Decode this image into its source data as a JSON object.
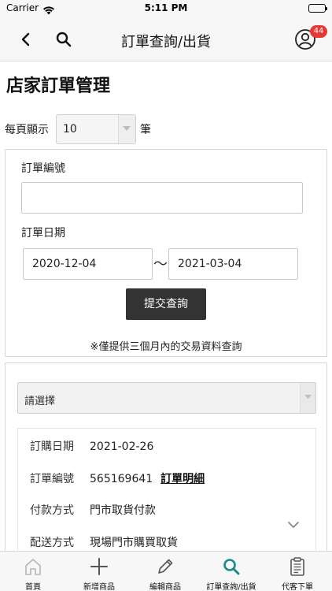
{
  "status_bar": {
    "carrier": "Carrier",
    "time": "5:11 PM"
  },
  "nav": {
    "title": "訂單查詢/出貨",
    "badge_count": "44"
  },
  "page": {
    "heading": "店家訂單管理"
  },
  "page_size": {
    "label": "每頁顯示",
    "value": "10",
    "unit": "筆"
  },
  "search": {
    "order_no_label": "訂單編號",
    "order_no_value": "",
    "date_label": "訂單日期",
    "date_from": "2020-12-04",
    "date_sep": "〜",
    "date_to": "2021-03-04",
    "submit_label": "提交查詢",
    "notice": "※僅提供三個月內的交易資料查詢"
  },
  "results": {
    "filter_value": "請選擇",
    "order": {
      "date_key": "訂購日期",
      "date_value": "2021-02-26",
      "no_key": "訂單編號",
      "no_value": "565169641",
      "detail_link": "訂單明細",
      "pay_key": "付款方式",
      "pay_value": "門市取貨付款",
      "ship_key": "配送方式",
      "ship_value": "現場門市購買取貨"
    }
  },
  "tabs": [
    {
      "label": "首頁",
      "icon": "home-icon"
    },
    {
      "label": "新增商品",
      "icon": "plus-icon"
    },
    {
      "label": "編輯商品",
      "icon": "pencil-icon"
    },
    {
      "label": "訂單查詢/出貨",
      "icon": "search-icon"
    },
    {
      "label": "代客下單",
      "icon": "clipboard-icon"
    }
  ],
  "colors": {
    "accent": "#1a8a8a",
    "badge": "#e53935",
    "button": "#333333"
  }
}
